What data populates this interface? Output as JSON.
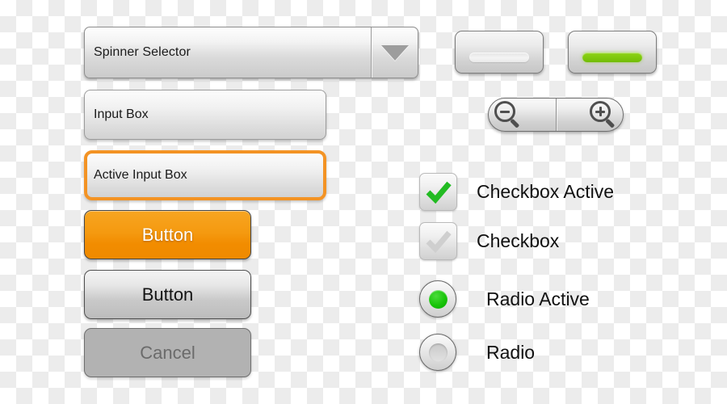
{
  "widgets": {
    "spinner": {
      "label": "Spinner Selector",
      "arrow_icon": "chevron-down-icon"
    },
    "inputs": [
      {
        "value": "Input Box",
        "state": "normal"
      },
      {
        "value": "Active Input Box",
        "state": "active",
        "focus_color": "#f39324"
      }
    ],
    "buttons": [
      {
        "label": "Button",
        "style": "primary",
        "color": "#f29500",
        "text_color": "#ffffff"
      },
      {
        "label": "Button",
        "style": "default",
        "color": "#d8d8d8",
        "text_color": "#131313"
      },
      {
        "label": "Cancel",
        "style": "disabled",
        "color": "#b2b2b2",
        "text_color": "#6b6b6b"
      }
    ],
    "toggles": [
      {
        "state": "off",
        "bar_color": "#ededed"
      },
      {
        "state": "on",
        "bar_color": "#7ec80c"
      }
    ],
    "zoom_control": {
      "zoom_out_icon": "magnifier-minus-icon",
      "zoom_in_icon": "magnifier-plus-icon"
    },
    "checkboxes": [
      {
        "label": "Checkbox Active",
        "checked": true,
        "check_color": "#22bb22"
      },
      {
        "label": "Checkbox",
        "checked": false,
        "check_color": "#cccccc"
      }
    ],
    "radios": [
      {
        "label": "Radio Active",
        "selected": true,
        "dot_color": "#18c409"
      },
      {
        "label": "Radio",
        "selected": false,
        "dot_color": "#d5d5d5"
      }
    ]
  },
  "canvas": {
    "background": "transparency-checkerboard",
    "checker_light": "#ffffff",
    "checker_dark": "#ececec"
  }
}
